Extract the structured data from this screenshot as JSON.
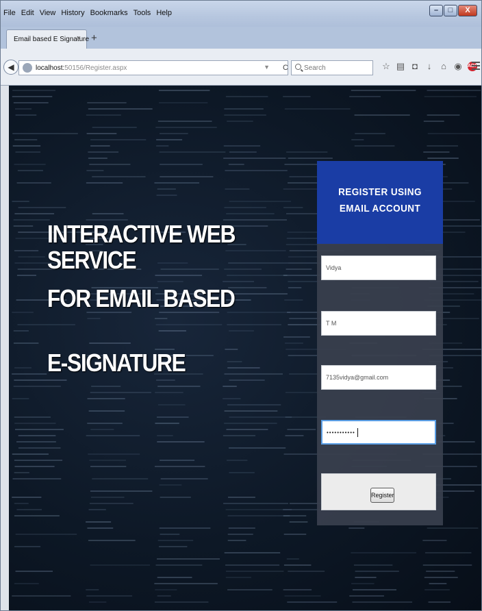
{
  "menu": [
    "File",
    "Edit",
    "View",
    "History",
    "Bookmarks",
    "Tools",
    "Help"
  ],
  "window_controls": [
    "minimize",
    "maximize",
    "close"
  ],
  "tab": {
    "title": "Email based E Signature",
    "close": "×",
    "new_tab": "+"
  },
  "nav": {
    "url_host": "localhost:",
    "url_path": "50156/Register.aspx",
    "search_placeholder": "Search",
    "toolbar_icons": [
      "star-icon",
      "reading-list-icon",
      "pocket-icon",
      "download-icon",
      "home-icon",
      "chat-icon",
      "adblock-icon"
    ],
    "adblock_label": "ABP"
  },
  "heading": {
    "line1": "INTERACTIVE WEB SERVICE",
    "line2": "FOR EMAIL BASED",
    "line3": "E-SIGNATURE"
  },
  "form": {
    "title": "REGISTER USING EMAIL ACCOUNT",
    "first_name": "Vidya",
    "last_name": "T M",
    "email": "7135vidya@gmail.com",
    "password_mask": "•••••••••••",
    "submit_label": "Register"
  },
  "colors": {
    "panel_header": "#1a3da5",
    "page_background": "#0d1826",
    "focus_ring": "#5b9fe6"
  }
}
